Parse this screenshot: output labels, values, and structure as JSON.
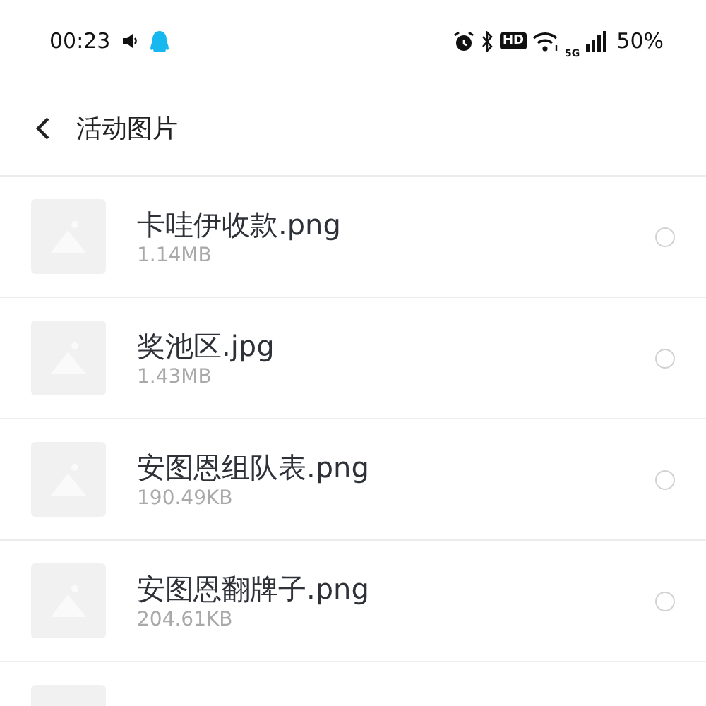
{
  "status_bar": {
    "time": "00:23",
    "hd_badge": "HD",
    "network": "5G",
    "battery": "50%"
  },
  "header": {
    "title": "活动图片"
  },
  "files": [
    {
      "name": "卡哇伊收款.png",
      "size": "1.14MB",
      "selected": false
    },
    {
      "name": "奖池区.jpg",
      "size": "1.43MB",
      "selected": false
    },
    {
      "name": "安图恩组队表.png",
      "size": "190.49KB",
      "selected": false
    },
    {
      "name": "安图恩翻牌子.png",
      "size": "204.61KB",
      "selected": false
    }
  ],
  "more_rows_below": true
}
